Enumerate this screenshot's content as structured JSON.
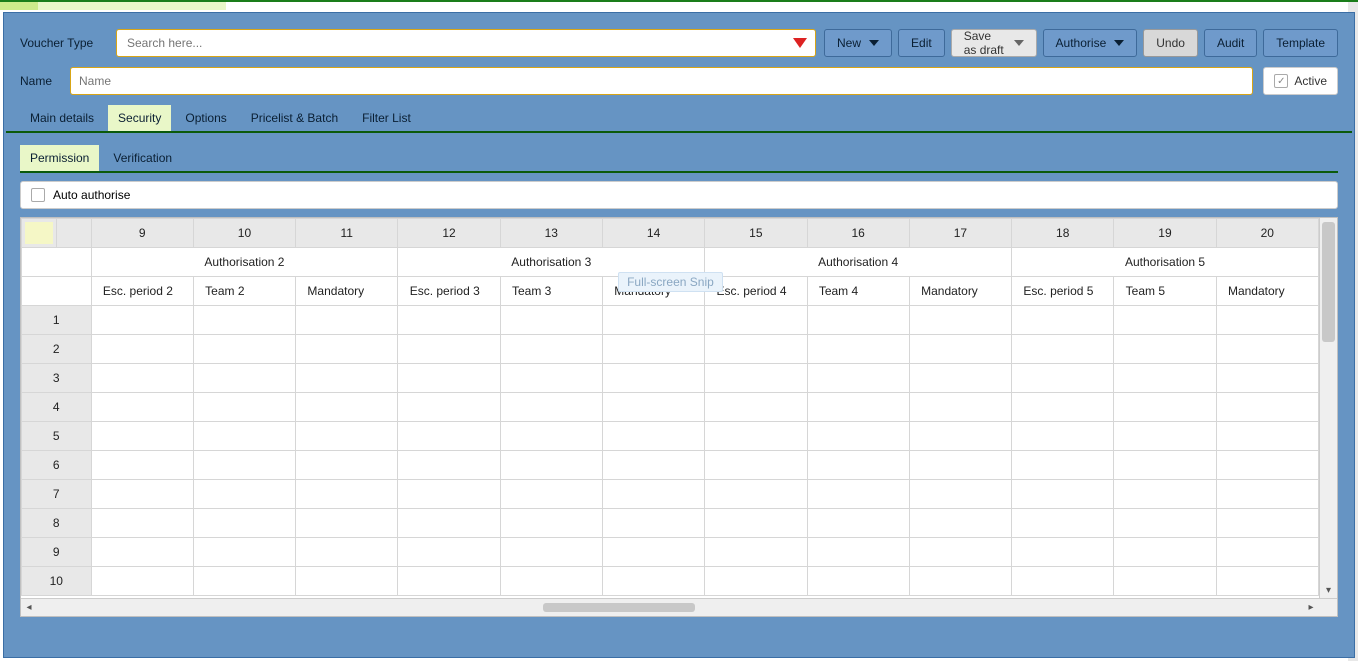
{
  "toolbar": {
    "voucher_type_label": "Voucher Type",
    "search_placeholder": "Search here...",
    "new": "New",
    "edit": "Edit",
    "save_draft": "Save as draft",
    "authorise": "Authorise",
    "undo": "Undo",
    "audit": "Audit",
    "template": "Template"
  },
  "name_field": {
    "label": "Name",
    "placeholder": "Name"
  },
  "active": {
    "label": "Active",
    "checked": true
  },
  "tabs": {
    "main_details": "Main details",
    "security": "Security",
    "options": "Options",
    "pricelist": "Pricelist & Batch",
    "filter": "Filter List",
    "active": "security"
  },
  "subtabs": {
    "permission": "Permission",
    "verification": "Verification",
    "active": "permission"
  },
  "auto_authorise": {
    "label": "Auto authorise",
    "checked": false
  },
  "grid": {
    "col_numbers": [
      "9",
      "10",
      "11",
      "12",
      "13",
      "14",
      "15",
      "16",
      "17",
      "18",
      "19",
      "20"
    ],
    "groups": [
      {
        "label": "Authorisation 2",
        "span": 3
      },
      {
        "label": "Authorisation 3",
        "span": 3
      },
      {
        "label": "Authorisation 4",
        "span": 3
      },
      {
        "label": "Authorisation 5",
        "span": 3
      }
    ],
    "sub_headers": [
      "Esc. period 2",
      "Team 2",
      "Mandatory",
      "Esc. period 3",
      "Team 3",
      "Mandatory",
      "Esc. period 4",
      "Team 4",
      "Mandatory",
      "Esc. period 5",
      "Team 5",
      "Mandatory"
    ],
    "row_numbers": [
      "1",
      "2",
      "3",
      "4",
      "5",
      "6",
      "7",
      "8",
      "9",
      "10"
    ]
  },
  "floating": "Full-screen Snip"
}
